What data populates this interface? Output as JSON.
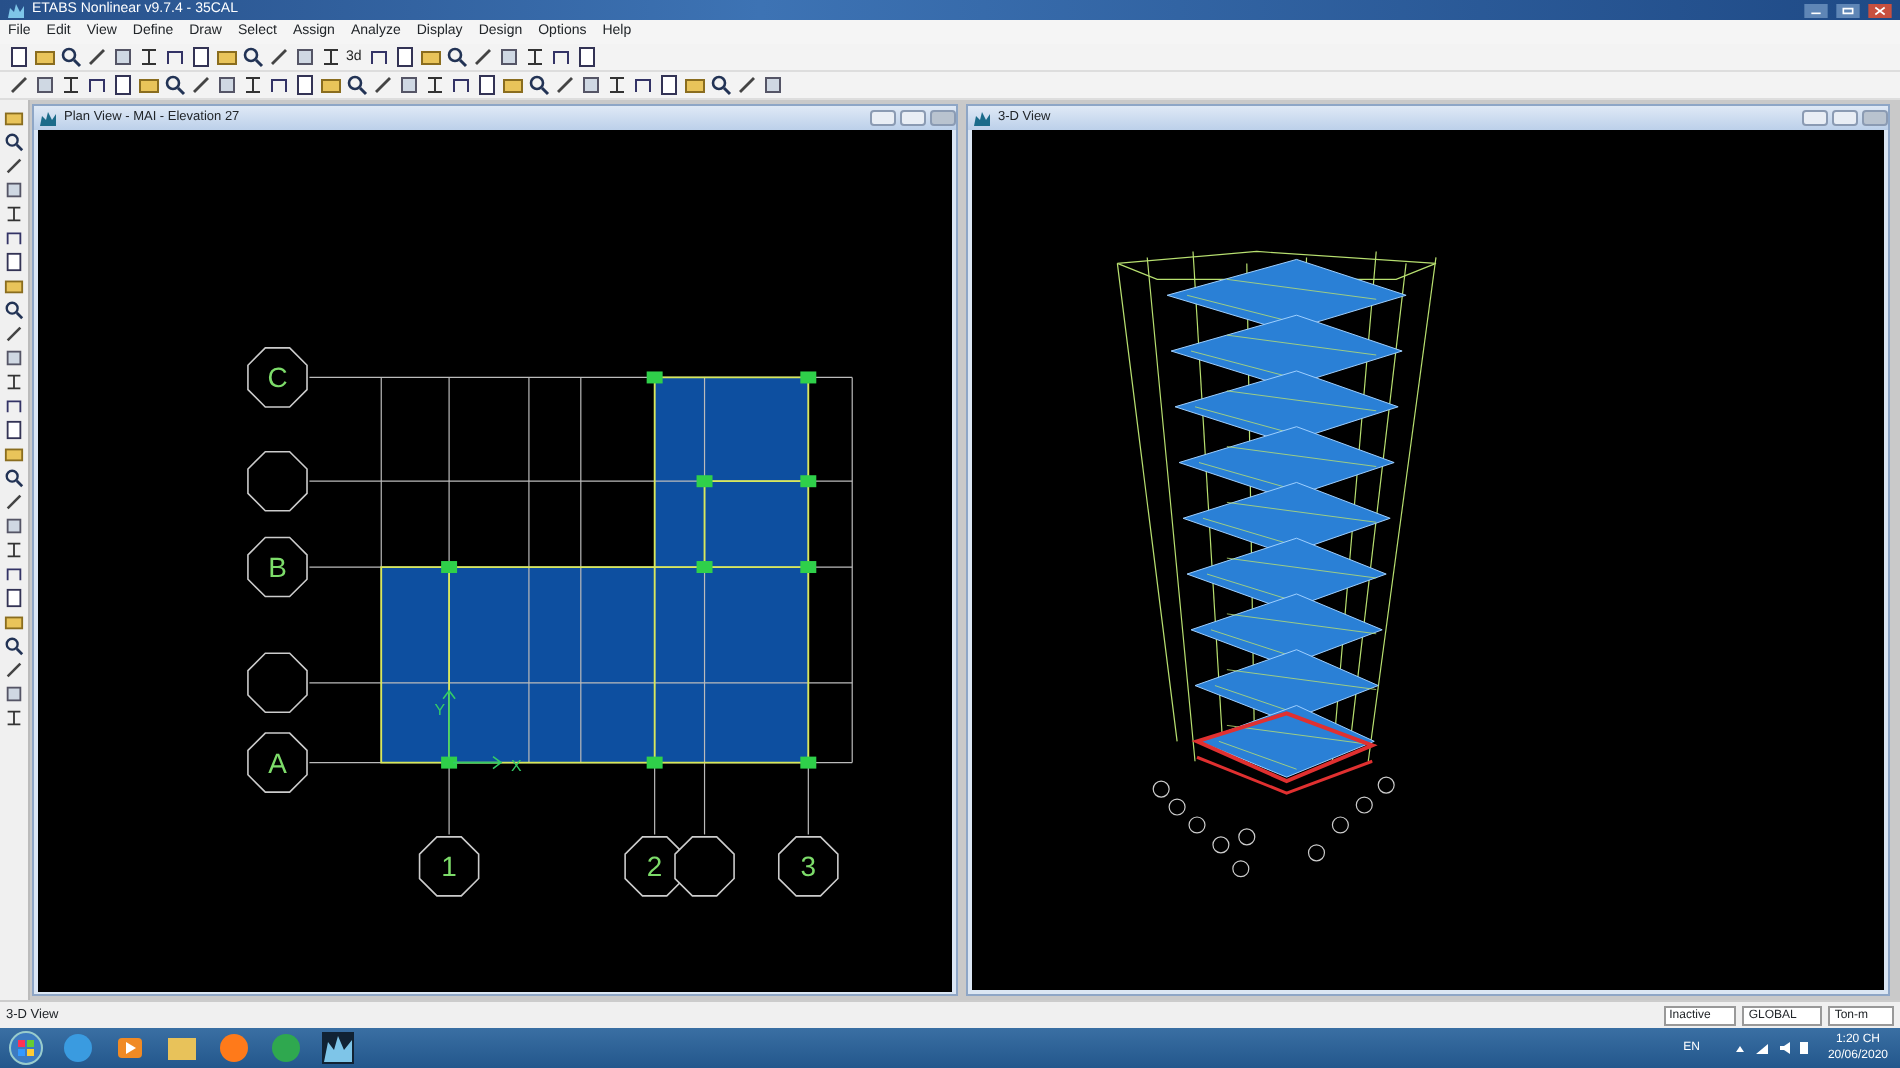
{
  "window": {
    "title": "ETABS Nonlinear v9.7.4 - 35CAL"
  },
  "menu": [
    {
      "label": "File"
    },
    {
      "label": "Edit"
    },
    {
      "label": "View"
    },
    {
      "label": "Define"
    },
    {
      "label": "Draw"
    },
    {
      "label": "Select"
    },
    {
      "label": "Assign"
    },
    {
      "label": "Analyze"
    },
    {
      "label": "Display"
    },
    {
      "label": "Design"
    },
    {
      "label": "Options"
    },
    {
      "label": "Help"
    }
  ],
  "toolbar": {
    "text_button": "3d"
  },
  "plan_view": {
    "title": "Plan View - MAI - Elevation 27",
    "grid_rows": [
      {
        "kind": "labeled",
        "label": "C"
      },
      {
        "kind": "blank"
      },
      {
        "kind": "labeled",
        "label": "B"
      },
      {
        "kind": "blank"
      },
      {
        "kind": "labeled",
        "label": "A"
      }
    ],
    "grid_columns": [
      {
        "kind": "labeled",
        "label": "1"
      },
      {
        "kind": "labeled",
        "label": "2"
      },
      {
        "kind": "blank"
      },
      {
        "kind": "labeled",
        "label": "3"
      }
    ],
    "axes": [
      "Y",
      "X"
    ]
  },
  "view_3d": {
    "title": "3-D View"
  },
  "status_bar": {
    "text": "3-D View",
    "dropdowns": [
      "Inactive",
      "GLOBAL",
      "Ton-m"
    ]
  },
  "taskbar": {
    "language": "EN",
    "time": "1:20 CH",
    "date": "20/06/2020"
  }
}
